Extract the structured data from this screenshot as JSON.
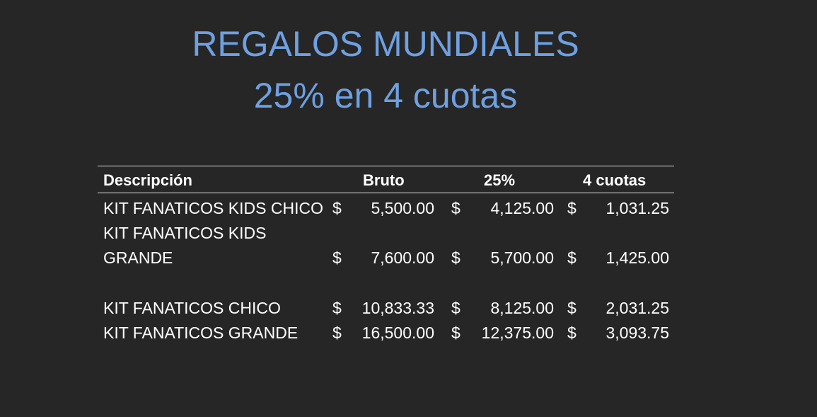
{
  "title_line1": "REGALOS MUNDIALES",
  "title_line2": "25% en 4 cuotas",
  "colors": {
    "background": "#262626",
    "title": "#6fa0e0",
    "text": "#ffffff"
  },
  "table": {
    "headers": {
      "descripcion": "Descripción",
      "bruto": "Bruto",
      "pct": "25%",
      "cuotas": "4 cuotas"
    },
    "rows": [
      {
        "desc_line1": "KIT FANATICOS KIDS CHICO",
        "desc_line2": "",
        "cur1": "$",
        "bruto": "5,500.00",
        "cur2": "$",
        "pct": "4,125.00",
        "cur3": "$",
        "cuotas": "1,031.25"
      },
      {
        "desc_line1": "KIT FANATICOS KIDS",
        "desc_line2": "GRANDE",
        "cur1": "$",
        "bruto": "7,600.00",
        "cur2": "$",
        "pct": "5,700.00",
        "cur3": "$",
        "cuotas": "1,425.00"
      },
      {
        "desc_line1": "KIT FANATICOS CHICO",
        "desc_line2": "",
        "cur1": "$",
        "bruto": "10,833.33",
        "cur2": "$",
        "pct": "8,125.00",
        "cur3": "$",
        "cuotas": "2,031.25"
      },
      {
        "desc_line1": "KIT FANATICOS GRANDE",
        "desc_line2": "",
        "cur1": "$",
        "bruto": "16,500.00",
        "cur2": "$",
        "pct": "12,375.00",
        "cur3": "$",
        "cuotas": "3,093.75"
      }
    ]
  }
}
